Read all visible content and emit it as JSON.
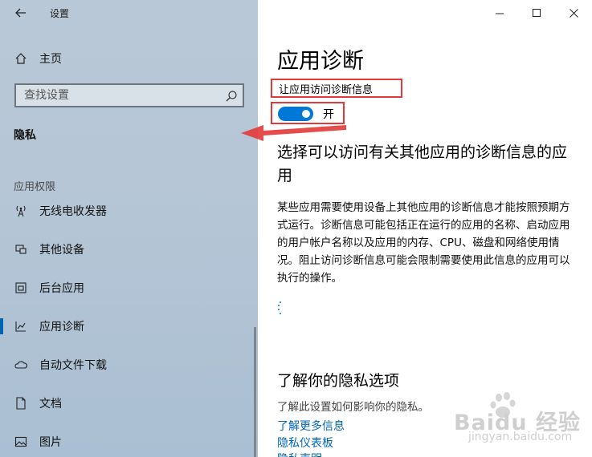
{
  "window": {
    "app_title": "设置",
    "controls": [
      "minimize-icon",
      "maximize-icon",
      "close-icon"
    ]
  },
  "sidebar": {
    "home_label": "主页",
    "search_placeholder": "查找设置",
    "section_title": "隐私",
    "group_label": "应用权限",
    "items": [
      {
        "label": "无线电收发器",
        "icon": "radio-icon",
        "active": false
      },
      {
        "label": "其他设备",
        "icon": "devices-icon",
        "active": false
      },
      {
        "label": "后台应用",
        "icon": "background-apps-icon",
        "active": false
      },
      {
        "label": "应用诊断",
        "icon": "diagnostics-icon",
        "active": true
      },
      {
        "label": "自动文件下载",
        "icon": "cloud-icon",
        "active": false
      },
      {
        "label": "文档",
        "icon": "document-icon",
        "active": false
      },
      {
        "label": "图片",
        "icon": "picture-icon",
        "active": false
      }
    ]
  },
  "main": {
    "title": "应用诊断",
    "toggle_caption": "让应用访问诊断信息",
    "toggle_state_label": "开",
    "toggle_on": true,
    "heading": "选择可以访问有关其他应用的诊断信息的应用",
    "description": "某些应用需要使用设备上其他应用的诊断信息才能按照预期方式运行。诊断信息可能包括正在运行的应用的名称、启动应用的用户帐户名称以及应用的内存、CPU、磁盘和网络使用情况。阻止访问诊断信息可能会限制需要使用此信息的应用可以执行的操作。",
    "privacy_heading": "了解你的隐私选项",
    "privacy_sub": "了解此设置如何影响你的隐私。",
    "links": [
      "了解更多信息",
      "隐私仪表板",
      "隐私声明"
    ]
  },
  "watermark": {
    "brand": "Baidu 经验",
    "url": "jingyan.baidu.com"
  },
  "colors": {
    "accent": "#0078d7",
    "highlight_border": "#e23a3a",
    "link": "#0066b4"
  }
}
